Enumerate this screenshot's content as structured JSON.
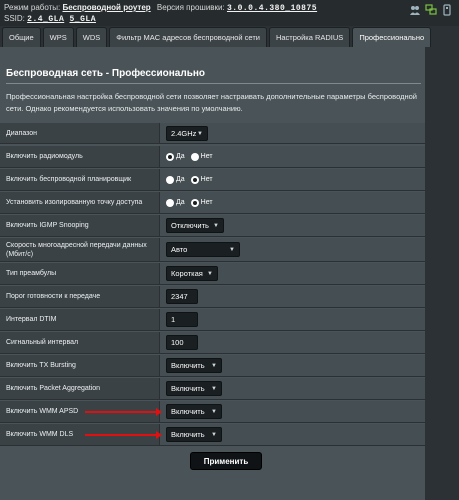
{
  "top": {
    "mode_label": "Режим работы:",
    "mode_value": "Беспроводной роутер",
    "fw_label": "Версия прошивки:",
    "fw_value": "3.0.0.4.380_10875",
    "ssid_label": "SSID:",
    "ssid_1": "2.4_GLA",
    "ssid_2": "5_GLA"
  },
  "tabs": [
    "Общие",
    "WPS",
    "WDS",
    "Фильтр MAC адресов беспроводной сети",
    "Настройка RADIUS",
    "Профессионально"
  ],
  "panel": {
    "title": "Беспроводная сеть - Профессионально",
    "description": "Профессиональная настройка беспроводной сети позволяет настраивать дополнительные параметры беспроводной сети. Однако рекомендуется использовать значения по умолчанию."
  },
  "rows": {
    "band": {
      "label": "Диапазон",
      "value": "2.4GHz"
    },
    "radio": {
      "label": "Включить радиомодуль",
      "yes": "Да",
      "no": "Нет",
      "selected": "yes"
    },
    "scheduler": {
      "label": "Включить беспроводной планировщик",
      "yes": "Да",
      "no": "Нет",
      "selected": "no"
    },
    "ap_isolated": {
      "label": "Установить изолированную точку доступа",
      "yes": "Да",
      "no": "Нет",
      "selected": "no"
    },
    "igmp": {
      "label": "Включить IGMP Snooping",
      "value": "Отключить"
    },
    "multicast": {
      "label": "Скорость многоадресной передачи данных (Мбит/с)",
      "value": "Авто"
    },
    "preamble": {
      "label": "Тип преамбулы",
      "value": "Короткая"
    },
    "rts": {
      "label": "Порог готовности к передаче",
      "value": "2347"
    },
    "dtim": {
      "label": "Интервал DTIM",
      "value": "1"
    },
    "beacon": {
      "label": "Сигнальный интервал",
      "value": "100"
    },
    "txburst": {
      "label": "Включить TX Bursting",
      "value": "Включить"
    },
    "pktagg": {
      "label": "Включить Packet Aggregation",
      "value": "Включить"
    },
    "wmm_apsd": {
      "label": "Включить WMM APSD",
      "value": "Включить"
    },
    "wmm_dls": {
      "label": "Включить WMM DLS",
      "value": "Включить"
    }
  },
  "apply_label": "Применить",
  "colors": {
    "accent_arrow": "#e01010",
    "panel": "#4a5357",
    "background": "#2b3134"
  }
}
